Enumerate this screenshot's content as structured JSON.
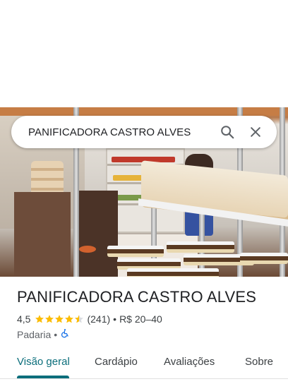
{
  "search": {
    "query": "PANIFICADORA CASTRO ALVES",
    "search_icon": "search-icon",
    "clear_icon": "close-icon"
  },
  "place": {
    "name": "PANIFICADORA CASTRO ALVES",
    "rating": "4,5",
    "stars_value": 4.5,
    "reviews": "(241)",
    "price_separator": "•",
    "price": "R$ 20–40",
    "category": "Padaria",
    "category_separator": "•",
    "accessibility_icon": "wheelchair-icon"
  },
  "tabs": [
    {
      "label": "Visão geral",
      "active": true
    },
    {
      "label": "Cardápio",
      "active": false
    },
    {
      "label": "Avaliações",
      "active": false
    },
    {
      "label": "Sobre",
      "active": false
    }
  ],
  "colors": {
    "accent": "#0b6e7b",
    "star": "#fbbc04",
    "accessibility": "#1a73e8"
  }
}
